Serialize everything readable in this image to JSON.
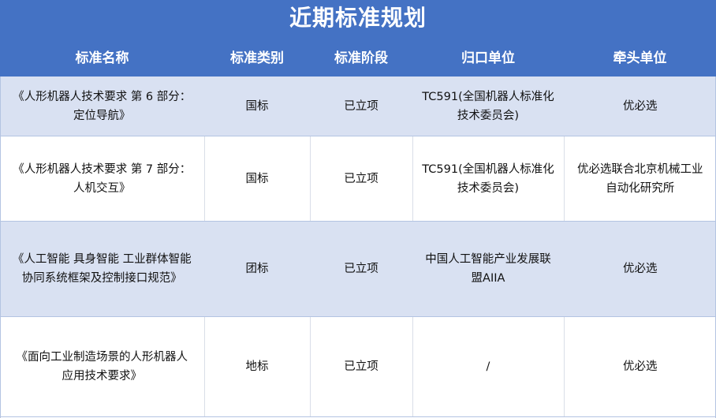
{
  "title": "近期标准规划",
  "headers": [
    "标准名称",
    "标准类别",
    "标准阶段",
    "归口单位",
    "牵头单位"
  ],
  "rows": [
    {
      "name_line1": "《人形机器人技术要求 第 6 部分：",
      "name_line2": "定位导航》",
      "category": "国标",
      "stage": "已立项",
      "org_line1": "TC591(全国机器人标准化",
      "org_line2": "技术委员会)",
      "lead_line1": "优必选",
      "lead_line2": ""
    },
    {
      "name_line1": "《人形机器人技术要求 第 7 部分：",
      "name_line2": "人机交互》",
      "category": "国标",
      "stage": "已立项",
      "org_line1": "TC591(全国机器人标准化",
      "org_line2": "技术委员会)",
      "lead_line1": "优必选联合北京机械工业",
      "lead_line2": "自动化研究所"
    },
    {
      "name_line1": "《人工智能 具身智能 工业群体智能",
      "name_line2": "协同系统框架及控制接口规范》",
      "category": "团标",
      "stage": "已立项",
      "org_line1": "中国人工智能产业发展联",
      "org_line2": "盟AIIA",
      "lead_line1": "优必选",
      "lead_line2": ""
    },
    {
      "name_line1": "《面向工业制造场景的人形机器人",
      "name_line2": "应用技术要求》",
      "category": "地标",
      "stage": "已立项",
      "org_line1": "/",
      "org_line2": "",
      "lead_line1": "优必选",
      "lead_line2": ""
    }
  ]
}
